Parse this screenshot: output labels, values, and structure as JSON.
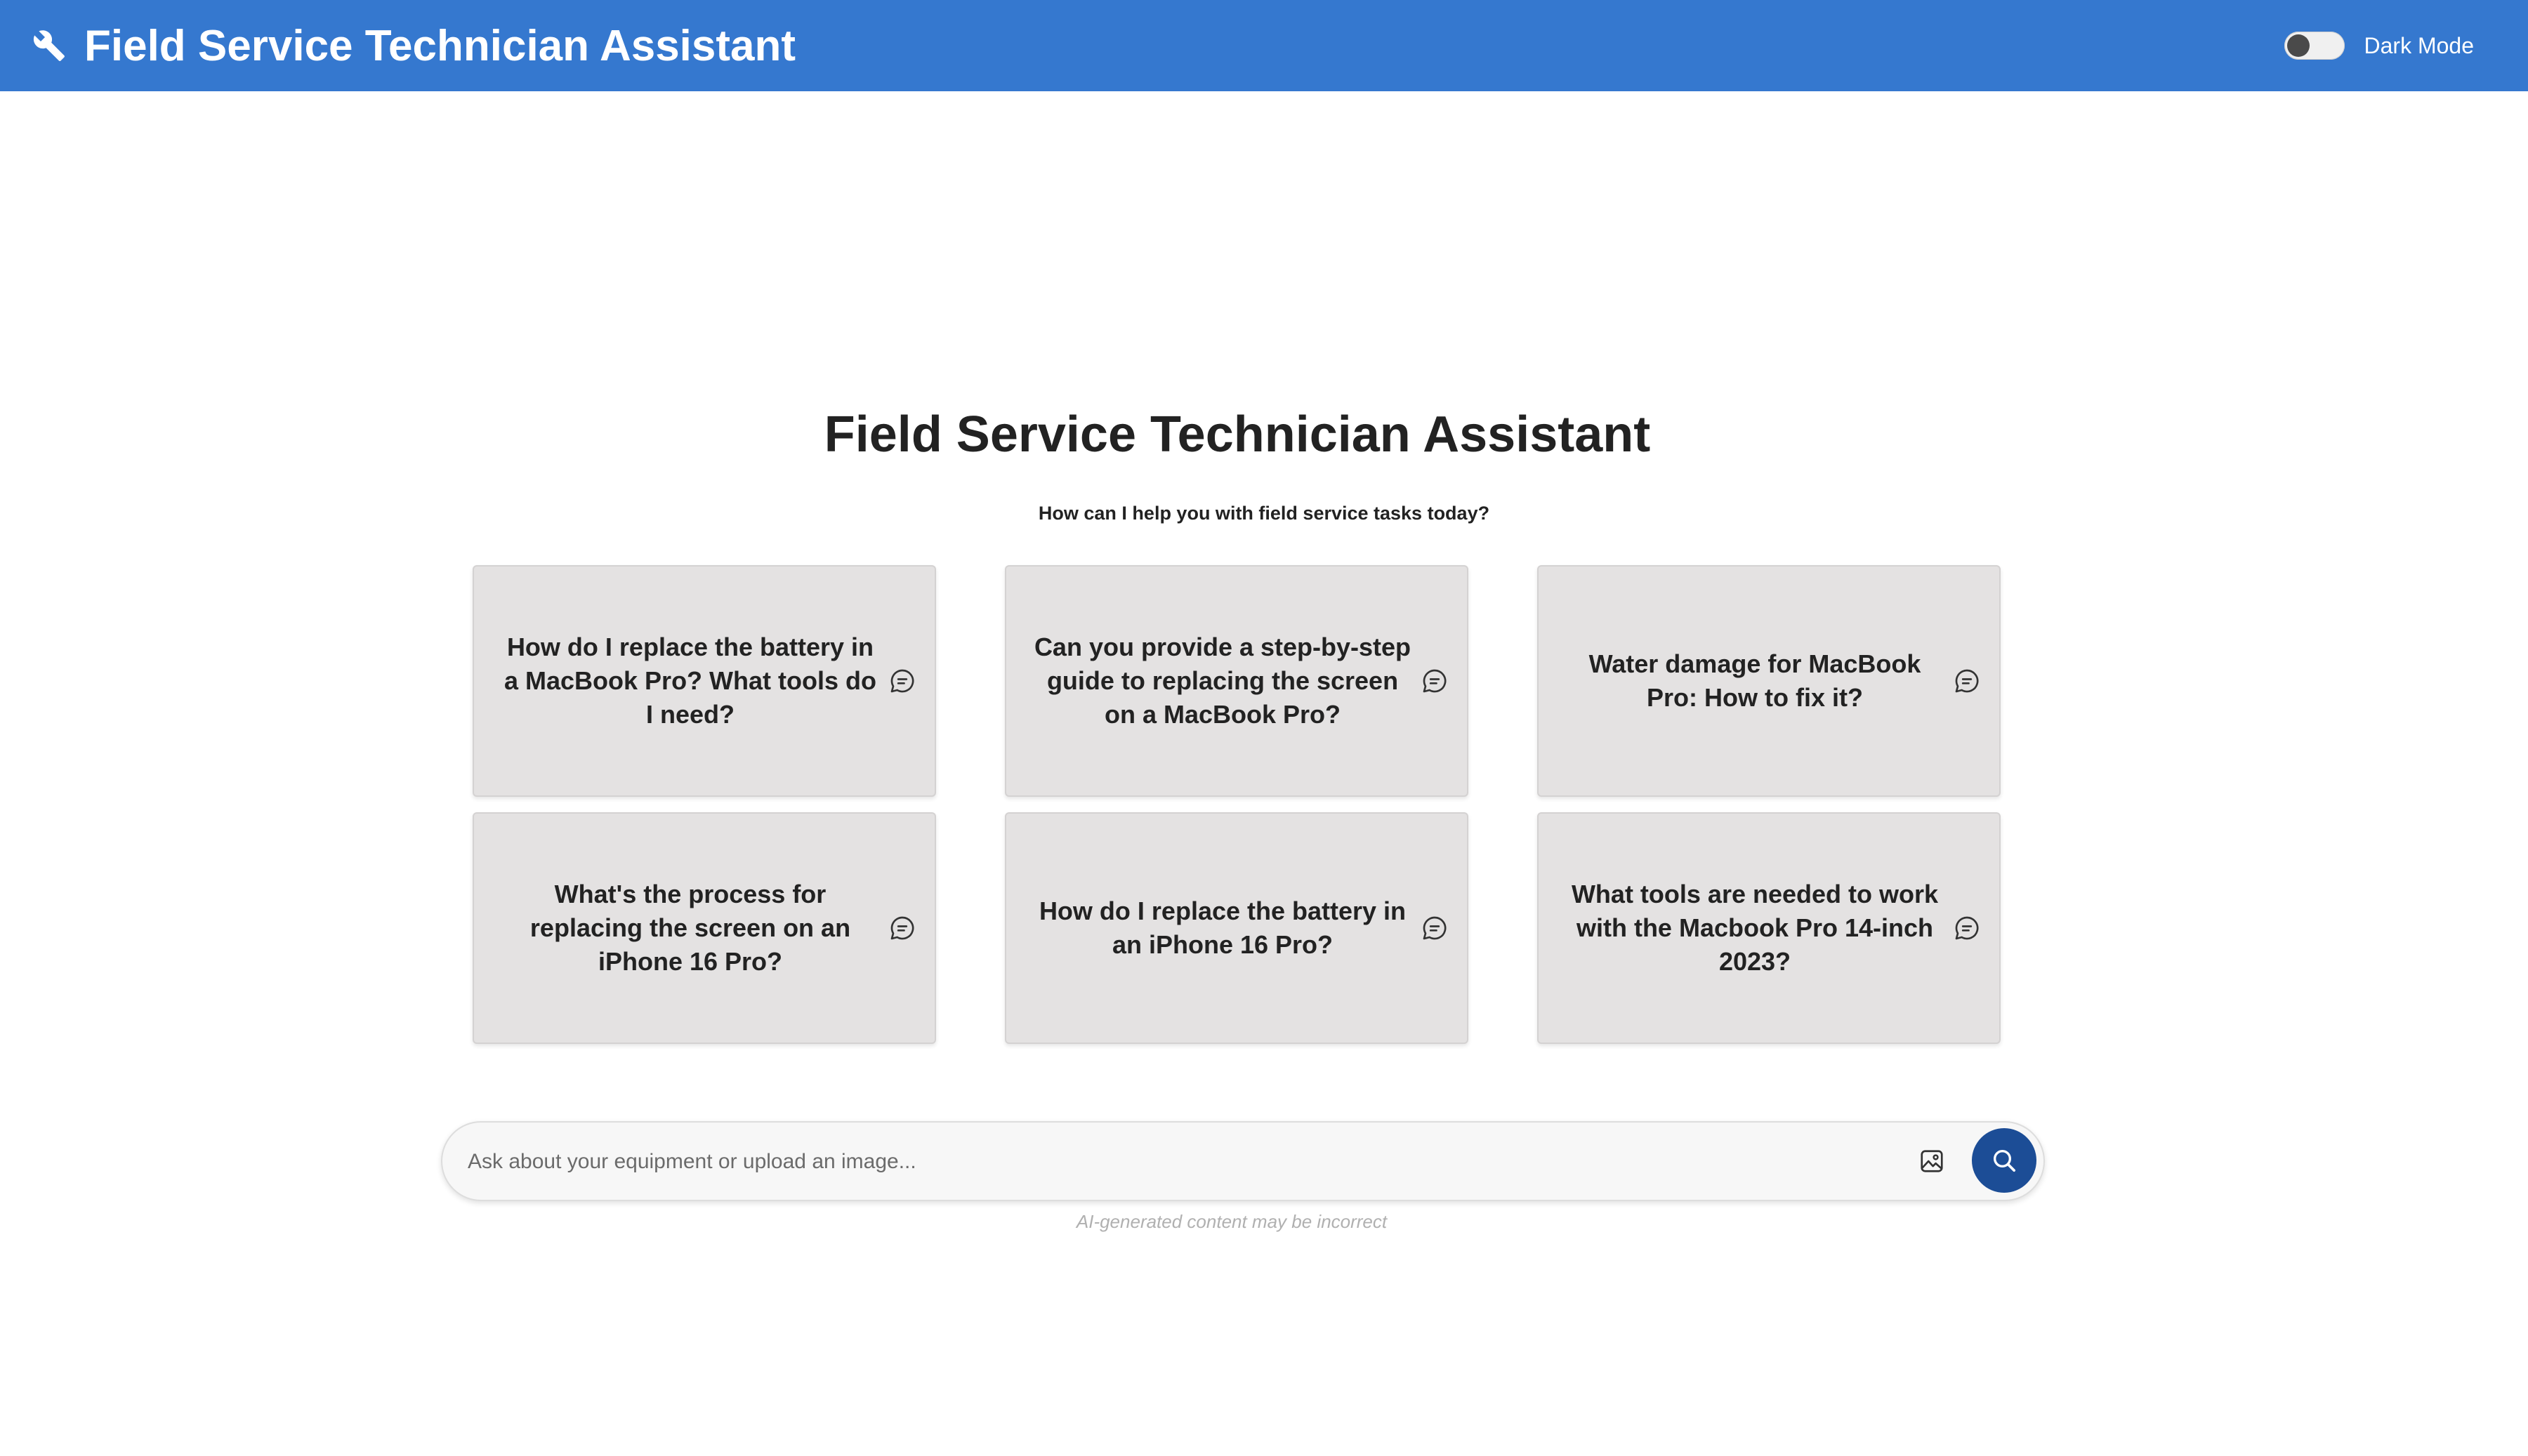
{
  "header": {
    "title": "Field Service Technician Assistant",
    "icon": "wrench-icon",
    "dark_mode_label": "Dark Mode",
    "dark_mode_enabled": false
  },
  "main": {
    "title": "Field Service Technician Assistant",
    "subtitle": "How can I help you with field service tasks today?",
    "suggestions": [
      {
        "text": "How do I replace the battery in a MacBook Pro? What tools do I need?",
        "icon": "chat-bubble-icon"
      },
      {
        "text": "Can you provide a step-by-step guide to replacing the screen on a MacBook Pro?",
        "icon": "chat-bubble-icon"
      },
      {
        "text": "Water damage for MacBook Pro: How to fix it?",
        "icon": "chat-bubble-icon"
      },
      {
        "text": "What's the process for replacing the screen on an iPhone 16 Pro?",
        "icon": "chat-bubble-icon"
      },
      {
        "text": "How do I replace the battery in an iPhone 16 Pro?",
        "icon": "chat-bubble-icon"
      },
      {
        "text": "What tools are needed to work with the Macbook Pro 14-inch 2023?",
        "icon": "chat-bubble-icon"
      }
    ]
  },
  "search": {
    "placeholder": "Ask about your equipment or upload an image...",
    "value": "",
    "upload_icon": "image-upload-icon",
    "button_icon": "search-icon"
  },
  "disclaimer": "AI-generated content may be incorrect",
  "colors": {
    "header_bg": "#3578cf",
    "card_bg": "#e4e2e2",
    "search_button_bg": "#1c4d96"
  }
}
